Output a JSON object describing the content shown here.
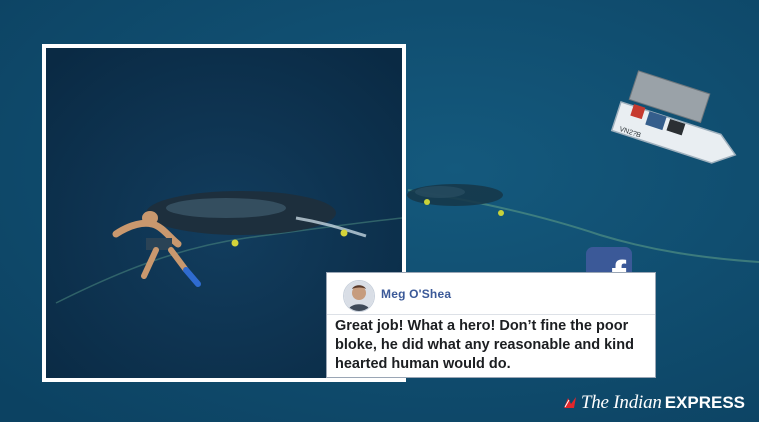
{
  "comment": {
    "author": "Meg O'Shea",
    "text": "Great job! What a hero! Don’t fine the poor bloke, he did what any reasonable and kind hearted human would do."
  },
  "facebook_badge": {
    "icon": "facebook-logo-icon",
    "letter": "f",
    "color": "#3b5998"
  },
  "branding": {
    "the_indian": "The Indian",
    "express": "EXPRESS"
  },
  "colors": {
    "sea": "#0e4a6a",
    "inset_sea": "#0b2f4c"
  }
}
